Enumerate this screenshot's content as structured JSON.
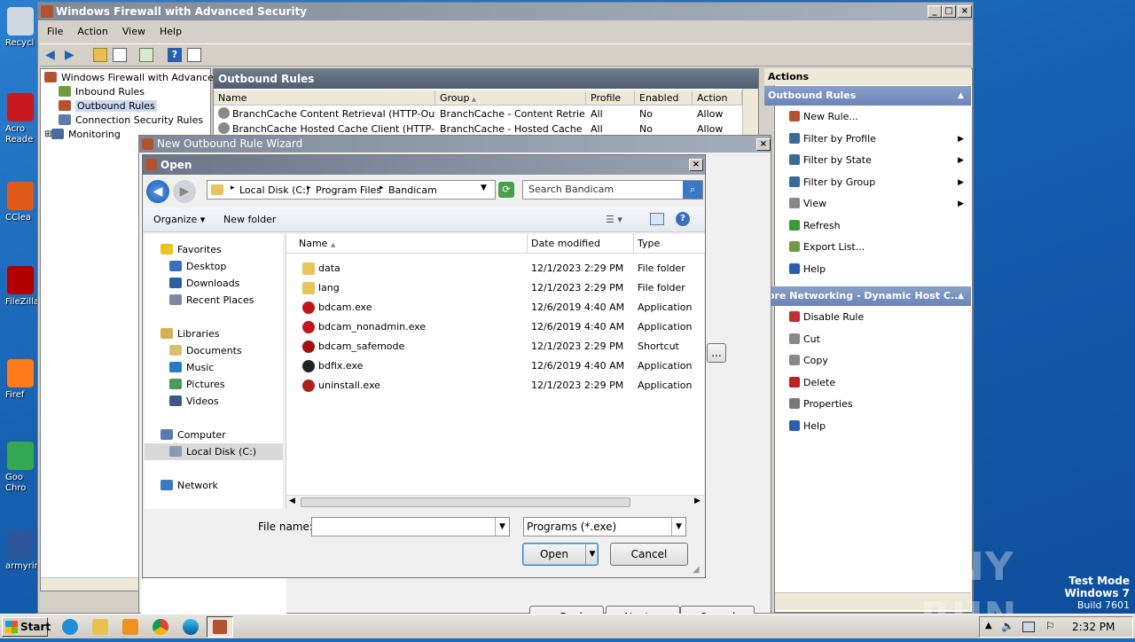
{
  "desktop": {
    "icons": [
      {
        "label": "Recycl",
        "color": "#cfd8e0"
      },
      {
        "label": "Acro\nReade",
        "color": "#c8191e"
      },
      {
        "label": "CClea",
        "color": "#e05a1a"
      },
      {
        "label": "FileZilla",
        "color": "#b00000"
      },
      {
        "label": "Firef",
        "color": "#ff7a18"
      },
      {
        "label": "Goo\nChro",
        "color": "#34a853"
      },
      {
        "label": "armyrin",
        "color": "#2b579a"
      }
    ]
  },
  "main_window": {
    "title": "Windows Firewall with Advanced Security",
    "menu": [
      "File",
      "Action",
      "View",
      "Help"
    ],
    "tree": [
      {
        "label": "Windows Firewall with Advanced S",
        "icon": "firewall-icon"
      },
      {
        "label": "Inbound Rules",
        "icon": "inbound-rules-icon"
      },
      {
        "label": "Outbound Rules",
        "icon": "outbound-rules-icon"
      },
      {
        "label": "Connection Security Rules",
        "icon": "connection-security-icon"
      },
      {
        "label": "Monitoring",
        "icon": "monitoring-icon"
      }
    ],
    "panel_title": "Outbound Rules",
    "columns": [
      "Name",
      "Group",
      "Profile",
      "Enabled",
      "Action"
    ],
    "rows": [
      [
        "BranchCache Content Retrieval (HTTP-Out)",
        "BranchCache - Content Retrie...",
        "All",
        "No",
        "Allow"
      ],
      [
        "BranchCache Hosted Cache Client (HTTP-Out)",
        "BranchCache - Hosted Cache ...",
        "All",
        "No",
        "Allow"
      ]
    ]
  },
  "actions": {
    "header": "Actions",
    "section1": "Outbound Rules",
    "items1": [
      {
        "label": "New Rule...",
        "icon": "new-rule-icon",
        "sub": false
      },
      {
        "label": "Filter by Profile",
        "icon": "filter-icon",
        "sub": true
      },
      {
        "label": "Filter by State",
        "icon": "filter-icon",
        "sub": true
      },
      {
        "label": "Filter by Group",
        "icon": "filter-icon",
        "sub": true
      },
      {
        "label": "View",
        "icon": "view-icon",
        "sub": true
      },
      {
        "label": "Refresh",
        "icon": "refresh-icon",
        "sub": false
      },
      {
        "label": "Export List...",
        "icon": "export-icon",
        "sub": false
      },
      {
        "label": "Help",
        "icon": "help-icon",
        "sub": false
      }
    ],
    "section2": "ore Networking - Dynamic Host C...",
    "items2": [
      {
        "label": "Disable Rule",
        "icon": "disable-icon"
      },
      {
        "label": "Cut",
        "icon": "cut-icon"
      },
      {
        "label": "Copy",
        "icon": "copy-icon"
      },
      {
        "label": "Delete",
        "icon": "delete-icon"
      },
      {
        "label": "Properties",
        "icon": "properties-icon"
      },
      {
        "label": "Help",
        "icon": "help-icon"
      }
    ]
  },
  "wizard": {
    "title": "New Outbound Rule Wizard",
    "buttons": [
      "< Back",
      "Next >",
      "Cancel"
    ],
    "browse": "..."
  },
  "open_dialog": {
    "title": "Open",
    "breadcrumb": [
      "Local Disk (C:)",
      "Program Files",
      "Bandicam"
    ],
    "search_placeholder": "Search Bandicam",
    "organize": "Organize",
    "new_folder": "New folder",
    "nav": {
      "favorites": "Favorites",
      "fav_items": [
        "Desktop",
        "Downloads",
        "Recent Places"
      ],
      "libraries": "Libraries",
      "lib_items": [
        "Documents",
        "Music",
        "Pictures",
        "Videos"
      ],
      "computer": "Computer",
      "computer_items": [
        "Local Disk (C:)"
      ],
      "network": "Network"
    },
    "columns": [
      "Name",
      "Date modified",
      "Type"
    ],
    "files": [
      {
        "name": "data",
        "date": "12/1/2023 2:29 PM",
        "type": "File folder",
        "icon": "folder-icon"
      },
      {
        "name": "lang",
        "date": "12/1/2023 2:29 PM",
        "type": "File folder",
        "icon": "folder-icon"
      },
      {
        "name": "bdcam.exe",
        "date": "12/6/2019 4:40 AM",
        "type": "Application",
        "icon": "bandicam-icon"
      },
      {
        "name": "bdcam_nonadmin.exe",
        "date": "12/6/2019 4:40 AM",
        "type": "Application",
        "icon": "bandicam-icon"
      },
      {
        "name": "bdcam_safemode",
        "date": "12/1/2023 2:29 PM",
        "type": "Shortcut",
        "icon": "shortcut-icon"
      },
      {
        "name": "bdfix.exe",
        "date": "12/6/2019 4:40 AM",
        "type": "Application",
        "icon": "wrench-icon"
      },
      {
        "name": "uninstall.exe",
        "date": "12/1/2023 2:29 PM",
        "type": "Application",
        "icon": "uninstall-icon"
      }
    ],
    "file_name_label": "File name:",
    "file_name_value": "",
    "filter": "Programs (*.exe)",
    "open": "Open",
    "cancel": "Cancel"
  },
  "taskbar": {
    "start": "Start",
    "time": "2:32 PM"
  },
  "watermark": {
    "brand": "ANY RUN",
    "line1": "Test Mode",
    "line2": "Windows 7",
    "line3": "Build 7601"
  }
}
